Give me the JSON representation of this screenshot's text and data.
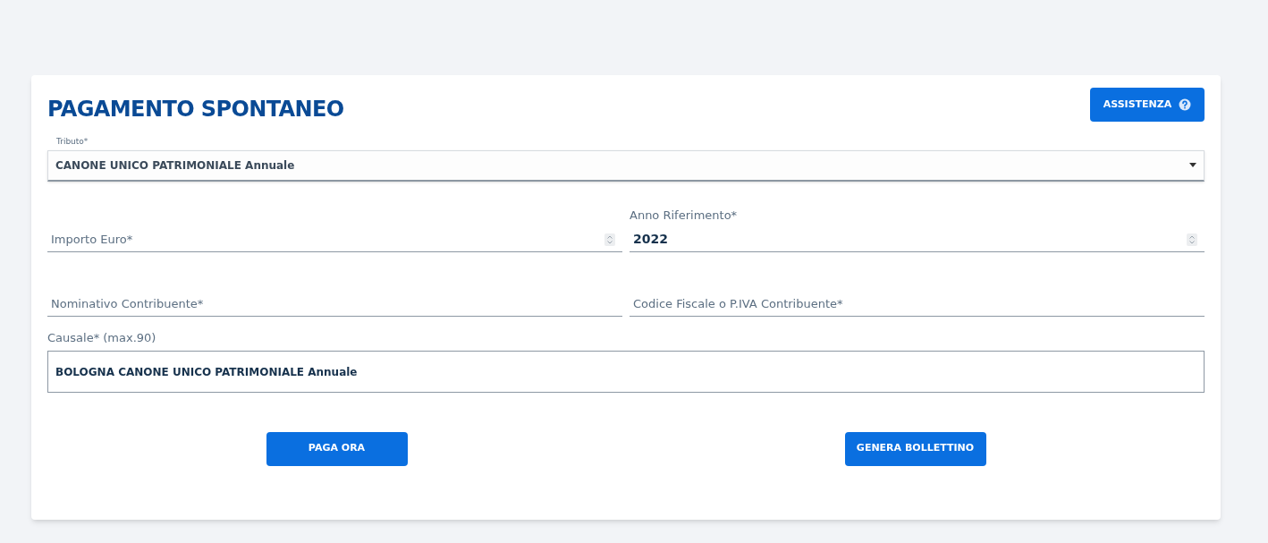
{
  "title": "PAGAMENTO SPONTANEO",
  "help_button": {
    "label": "ASSISTENZA"
  },
  "tributo": {
    "label": "Tributo*",
    "value": "CANONE UNICO PATRIMONIALE Annuale"
  },
  "rows": [
    [
      {
        "kind": "number",
        "label": "Importo Euro*"
      },
      {
        "kind": "number",
        "label": "Anno Riferimento*",
        "value": "2022"
      }
    ],
    [
      {
        "kind": "text",
        "label": "Nominativo Contribuente*"
      },
      {
        "kind": "text",
        "label": "Codice Fiscale o P.IVA Contribuente*"
      }
    ]
  ],
  "causale": {
    "label": "Causale* (max.90)",
    "value": "BOLOGNA CANONE UNICO PATRIMONIALE Annuale"
  },
  "actions": [
    "PAGA ORA",
    "GENERA BOLLETTINO"
  ]
}
